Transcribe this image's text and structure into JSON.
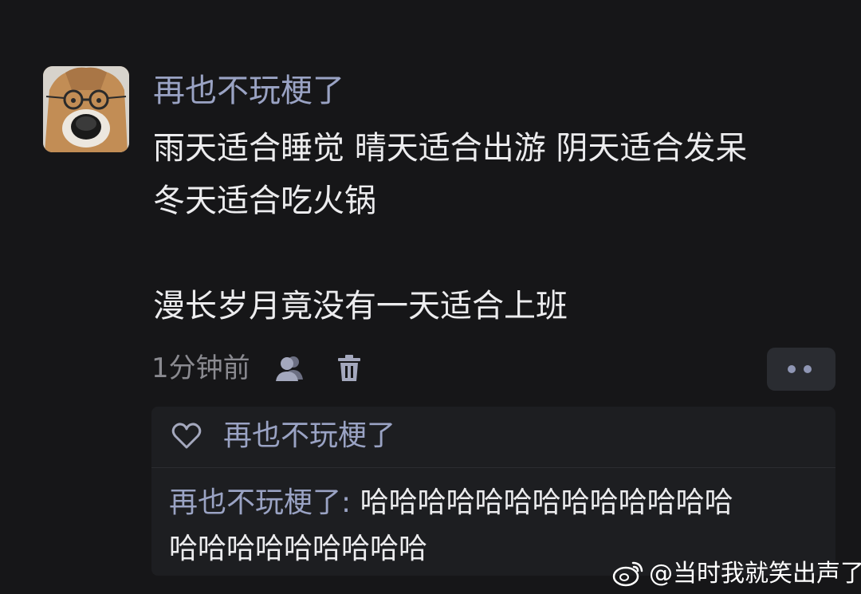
{
  "comment": {
    "username": "再也不玩梗了",
    "lines": [
      "雨天适合睡觉 晴天适合出游 阴天适合发呆",
      "冬天适合吃火锅",
      "漫长岁月竟没有一天适合上班"
    ],
    "timestamp": "1分钟前"
  },
  "icons": {
    "author_like": "person-icon",
    "delete": "trash-icon",
    "more": "more-dots-icon",
    "like": "heart-icon",
    "watermark": "weibo-logo"
  },
  "liked_by": {
    "name": "再也不玩梗了"
  },
  "reply": {
    "author": "再也不玩梗了:",
    "line1": "哈哈哈哈哈哈哈哈哈哈哈哈哈",
    "line2": "哈哈哈哈哈哈哈哈哈"
  },
  "watermark": {
    "text": "@当时我就笑出声了"
  },
  "colors": {
    "background": "#161618",
    "username": "#9aa3c4",
    "text": "#ececee",
    "muted": "#8a8a90",
    "panel": "#1d1e21"
  }
}
